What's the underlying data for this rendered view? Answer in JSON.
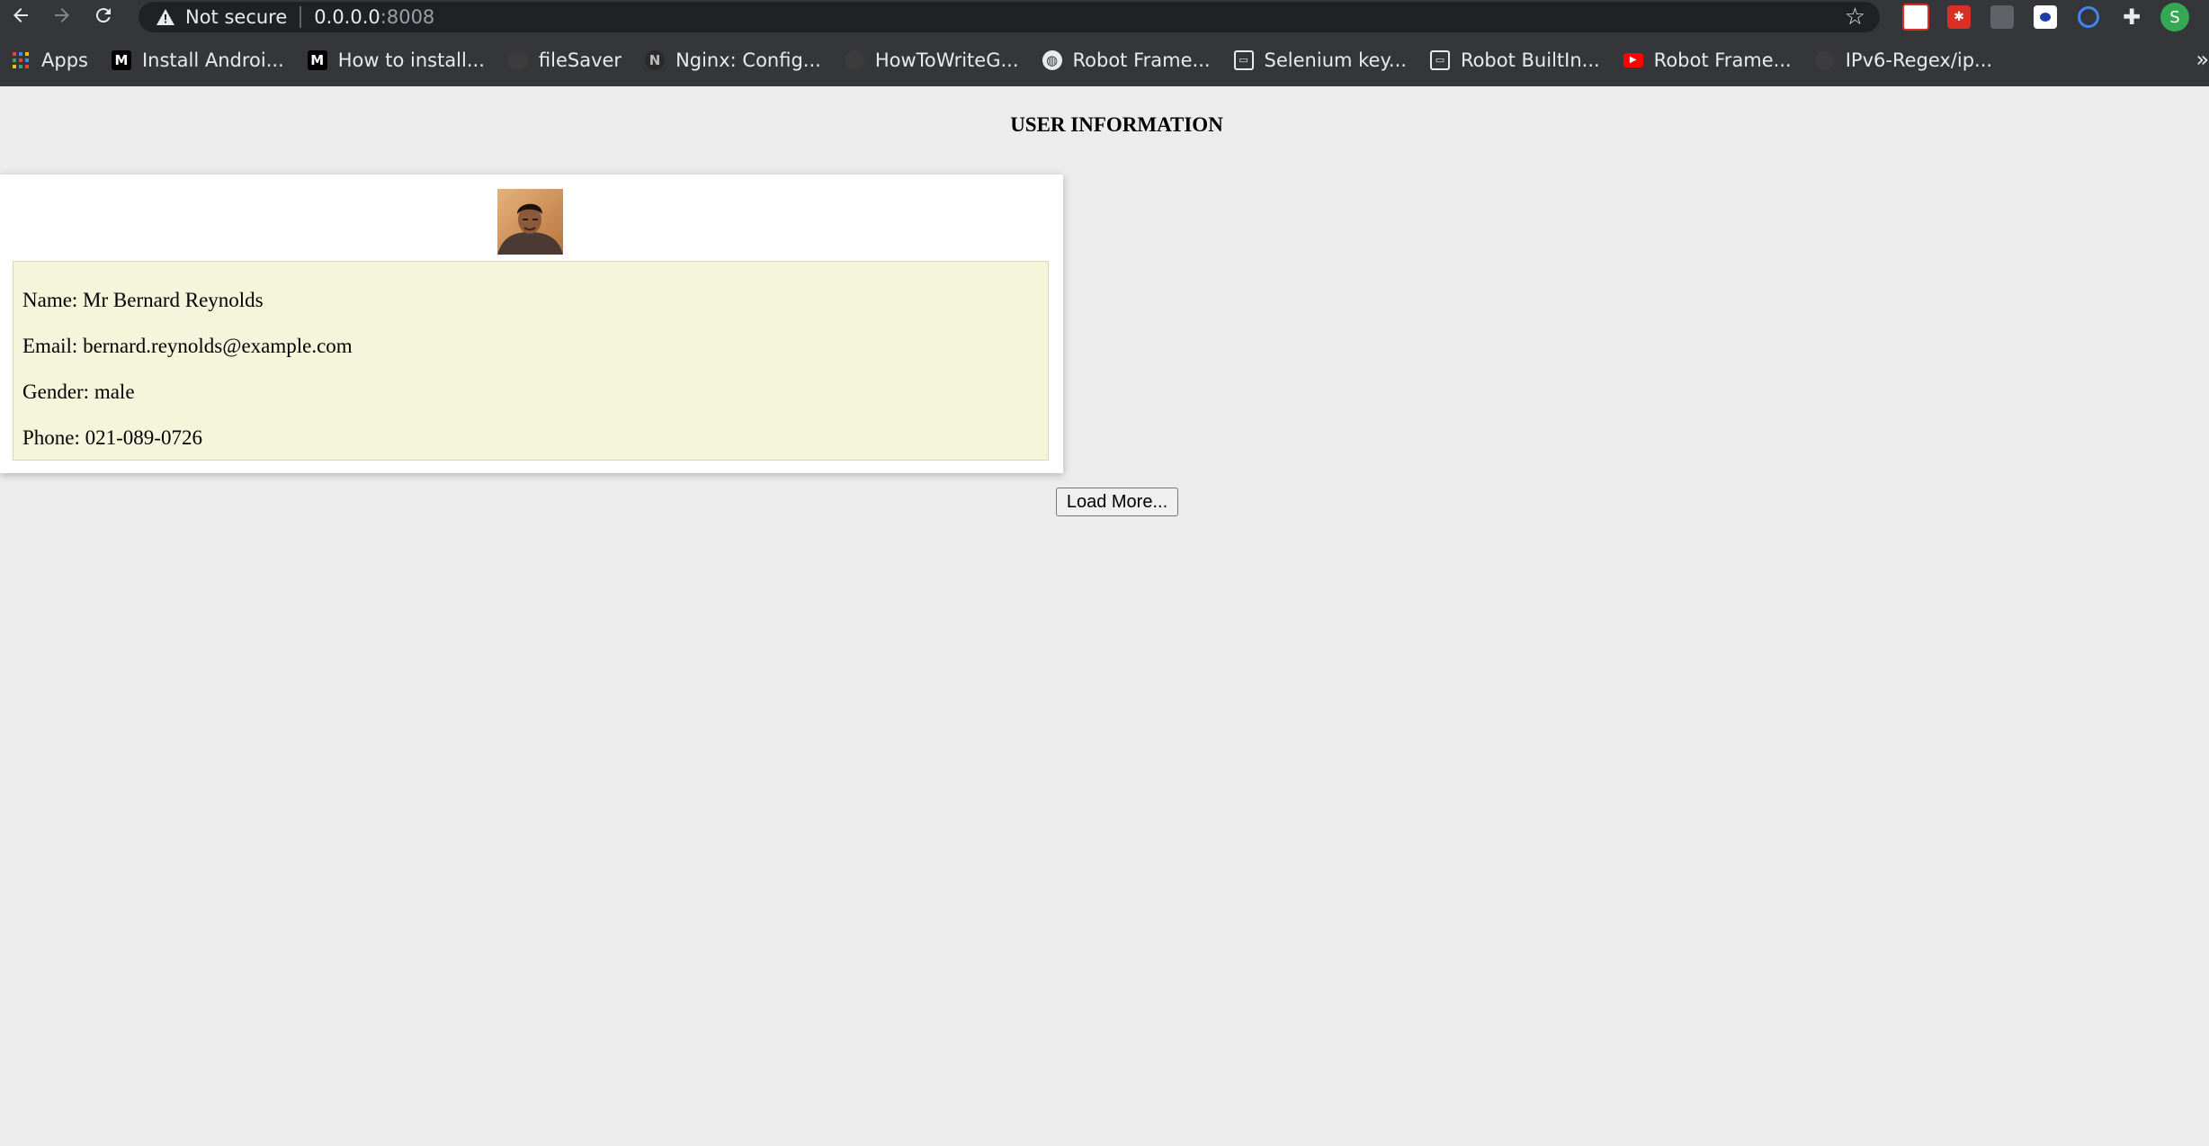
{
  "browser": {
    "security_label": "Not secure",
    "url_host": "0.0.0.0",
    "url_port": ":8008",
    "profile_initial": "S",
    "bookmarks": [
      {
        "label": "Apps",
        "icon": "apps-grid-icon"
      },
      {
        "label": "Install Androi...",
        "icon": "medium-icon"
      },
      {
        "label": "How to install...",
        "icon": "medium-icon"
      },
      {
        "label": "fileSaver",
        "icon": "github-icon"
      },
      {
        "label": "Nginx: Config...",
        "icon": "nginx-icon"
      },
      {
        "label": "HowToWriteG...",
        "icon": "github-icon"
      },
      {
        "label": "Robot Frame...",
        "icon": "globe-icon"
      },
      {
        "label": "Selenium key...",
        "icon": "robot-icon"
      },
      {
        "label": "Robot BuiltIn...",
        "icon": "robot-icon"
      },
      {
        "label": "Robot Frame...",
        "icon": "youtube-icon"
      },
      {
        "label": "IPv6-Regex/ip...",
        "icon": "github-icon"
      }
    ],
    "bookmarks_overflow": "»"
  },
  "page": {
    "title": "USER INFORMATION",
    "user": {
      "name_line": "Name: Mr Bernard Reynolds",
      "email_line": "Email: bernard.reynolds@example.com",
      "gender_line": "Gender: male",
      "phone_line": "Phone: 021-089-0726"
    },
    "load_more_label": "Load More..."
  }
}
